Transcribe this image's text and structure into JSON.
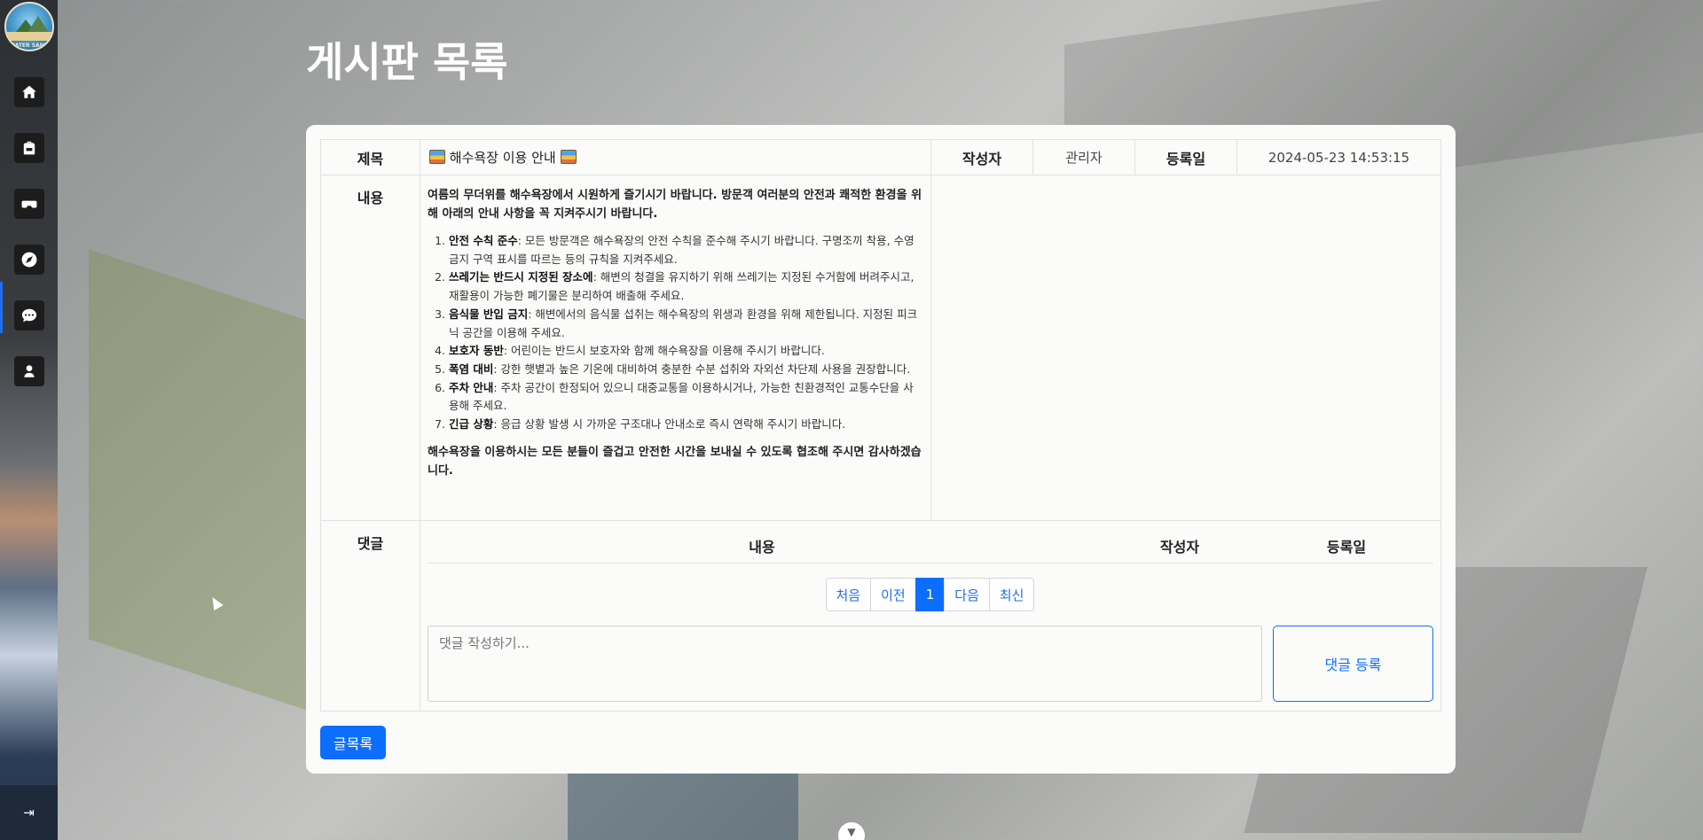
{
  "sidebar": {
    "logo_text": "WATER SAND",
    "items": [
      {
        "name": "home",
        "icon": "home-icon"
      },
      {
        "name": "backpack",
        "icon": "backpack-icon"
      },
      {
        "name": "vr",
        "icon": "vr-headset-icon"
      },
      {
        "name": "compass",
        "icon": "compass-icon"
      },
      {
        "name": "board",
        "icon": "chat-icon",
        "active": true
      },
      {
        "name": "user",
        "icon": "user-icon"
      }
    ],
    "collapse_label": "⇥"
  },
  "page": {
    "title": "게시판 목록"
  },
  "post": {
    "title_label": "제목",
    "title": "해수욕장 이용 안내",
    "author_label": "작성자",
    "author": "관리자",
    "date_label": "등록일",
    "date": "2024-05-23 14:53:15",
    "content_label": "내용",
    "intro": "여름의 무더위를 해수욕장에서 시원하게 즐기시기 바랍니다. 방문객 여러분의 안전과 쾌적한 환경을 위해 아래의 안내 사항을 꼭 지켜주시기 바랍니다.",
    "rules": [
      {
        "head": "안전 수칙 준수",
        "text": ": 모든 방문객은 해수욕장의 안전 수칙을 준수해 주시기 바랍니다. 구명조끼 착용, 수영 금지 구역 표시를 따르는 등의 규칙을 지켜주세요."
      },
      {
        "head": "쓰레기는 반드시 지정된 장소에",
        "text": ": 해변의 청결을 유지하기 위해 쓰레기는 지정된 수거함에 버려주시고, 재활용이 가능한 폐기물은 분리하여 배출해 주세요."
      },
      {
        "head": "음식물 반입 금지",
        "text": ": 해변에서의 음식물 섭취는 해수욕장의 위생과 환경을 위해 제한됩니다. 지정된 피크닉 공간을 이용해 주세요."
      },
      {
        "head": "보호자 동반",
        "text": ": 어린이는 반드시 보호자와 함께 해수욕장을 이용해 주시기 바랍니다."
      },
      {
        "head": "폭염 대비",
        "text": ": 강한 햇볕과 높은 기온에 대비하여 충분한 수분 섭취와 자외선 차단제 사용을 권장합니다."
      },
      {
        "head": "주차 안내",
        "text": ": 주차 공간이 한정되어 있으니 대중교통을 이용하시거나, 가능한 친환경적인 교통수단을 사용해 주세요."
      },
      {
        "head": "긴급 상황",
        "text": ": 응급 상황 발생 시 가까운 구조대나 안내소로 즉시 연락해 주시기 바랍니다."
      }
    ],
    "outro": "해수욕장을 이용하시는 모든 분들이 즐겁고 안전한 시간을 보내실 수 있도록 협조해 주시면 감사하겠습니다."
  },
  "comments": {
    "label": "댓글",
    "col_content": "내용",
    "col_author": "작성자",
    "col_date": "등록일",
    "pager": [
      "처음",
      "이전",
      "1",
      "다음",
      "최신"
    ],
    "pager_active": "1",
    "placeholder": "댓글 작성하기...",
    "submit_label": "댓글 등록"
  },
  "footer": {
    "list_button": "글목록"
  },
  "colors": {
    "primary": "#0d6efd",
    "sidebar_dark": "#1c1c1c"
  }
}
